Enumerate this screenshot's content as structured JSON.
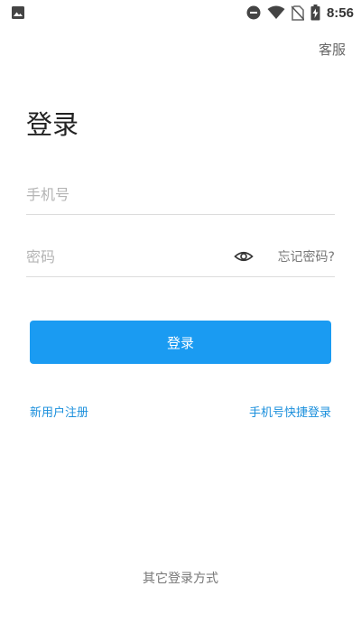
{
  "status_bar": {
    "time": "8:56",
    "icons": [
      "image-icon",
      "do-not-disturb-icon",
      "wifi-icon",
      "no-sim-icon",
      "battery-charging-icon"
    ]
  },
  "header": {
    "service_label": "客服"
  },
  "main": {
    "title": "登录",
    "phone_placeholder": "手机号",
    "phone_value": "",
    "password_placeholder": "密码",
    "password_value": "",
    "forgot_label": "忘记密码?",
    "login_button_label": "登录",
    "register_label": "新用户注册",
    "quick_login_label": "手机号快捷登录"
  },
  "footer": {
    "other_login_label": "其它登录方式"
  },
  "colors": {
    "accent": "#1a9bf2",
    "link": "#1a8fdc"
  }
}
